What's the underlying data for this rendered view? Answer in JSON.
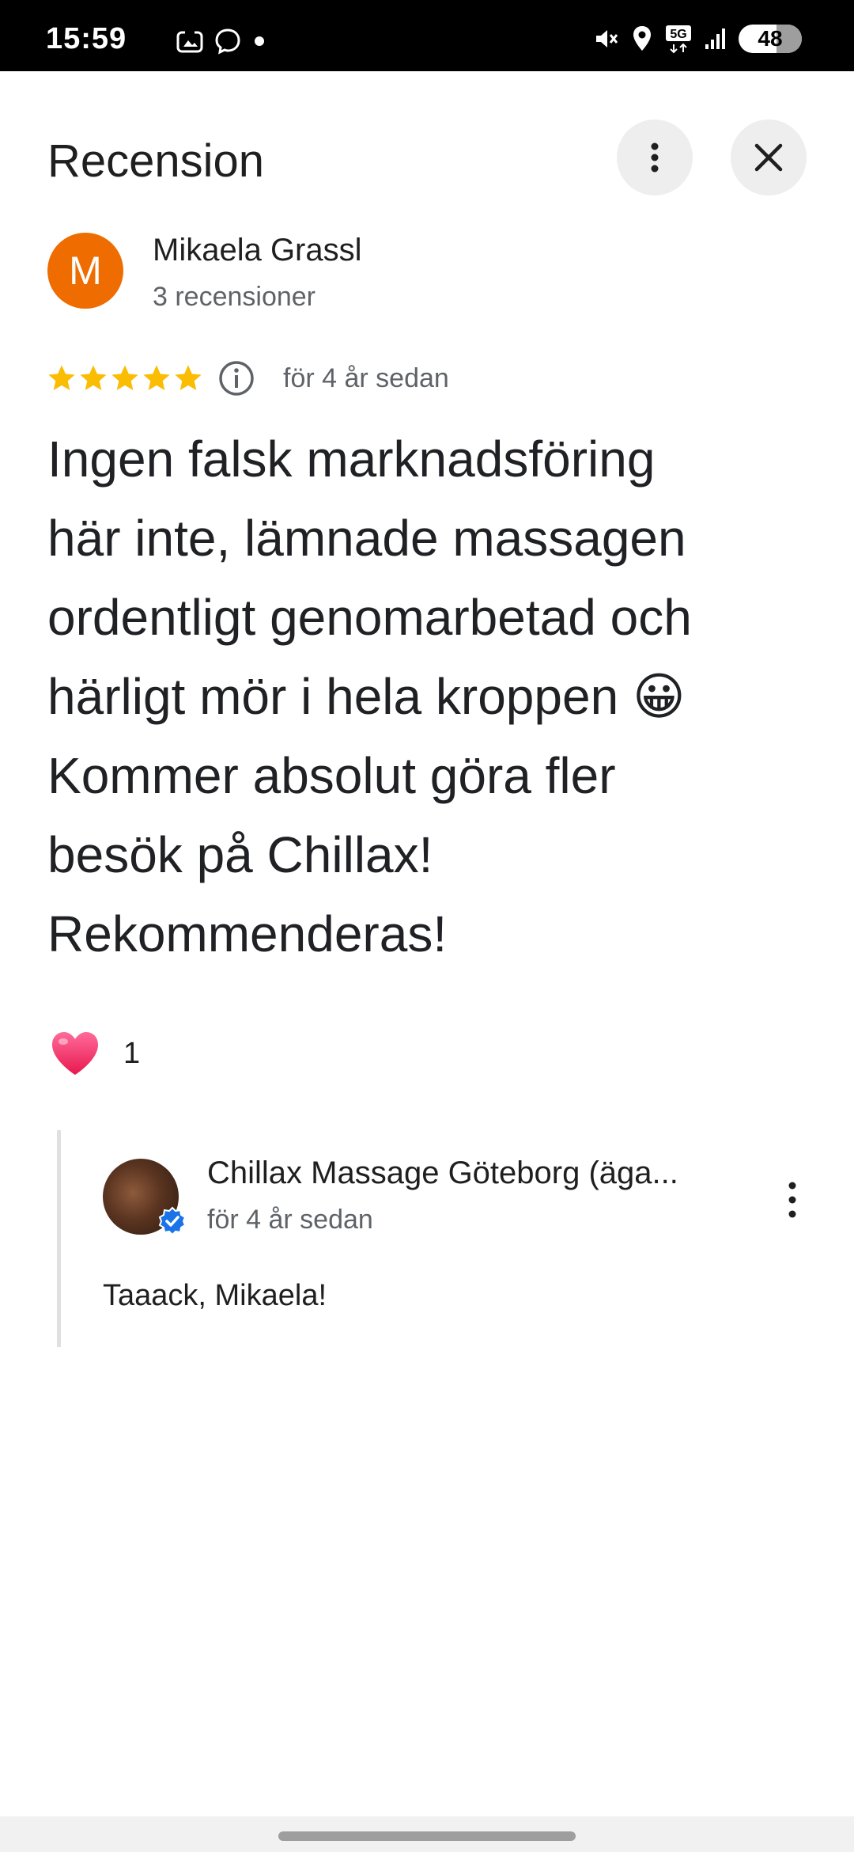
{
  "status_bar": {
    "time": "15:59",
    "battery": "48",
    "network": "5G",
    "left_icons": [
      "screenshot-icon",
      "messenger-icon",
      "dot-icon"
    ],
    "right_icons": [
      "vibrate-off-icon",
      "location-icon",
      "5g-icon",
      "signal-icon",
      "battery-icon"
    ]
  },
  "header": {
    "title": "Recension",
    "more_icon": "more-vert-icon",
    "close_icon": "close-icon"
  },
  "reviewer": {
    "initial": "M",
    "name": "Mikaela Grassl",
    "review_count": "3 recensioner",
    "avatar_color": "#ef6c00"
  },
  "rating": {
    "stars": 5,
    "star_color": "#fbbc04",
    "date": "för 4 år sedan"
  },
  "review": {
    "text_lines": [
      "Ingen falsk marknadsföring",
      "här inte, lämnade massagen",
      "ordentligt genomarbetad och",
      "härligt mör i hela kroppen 😀",
      "Kommer absolut göra fler",
      "besök på Chillax!",
      "Rekommenderas!"
    ]
  },
  "reaction": {
    "icon": "heart-icon",
    "count": "1"
  },
  "owner_reply": {
    "name": "Chillax Massage Göteborg (äga...",
    "date": "för 4 år sedan",
    "text": "Taaack, Mikaela!",
    "verified_color": "#1a73e8"
  }
}
